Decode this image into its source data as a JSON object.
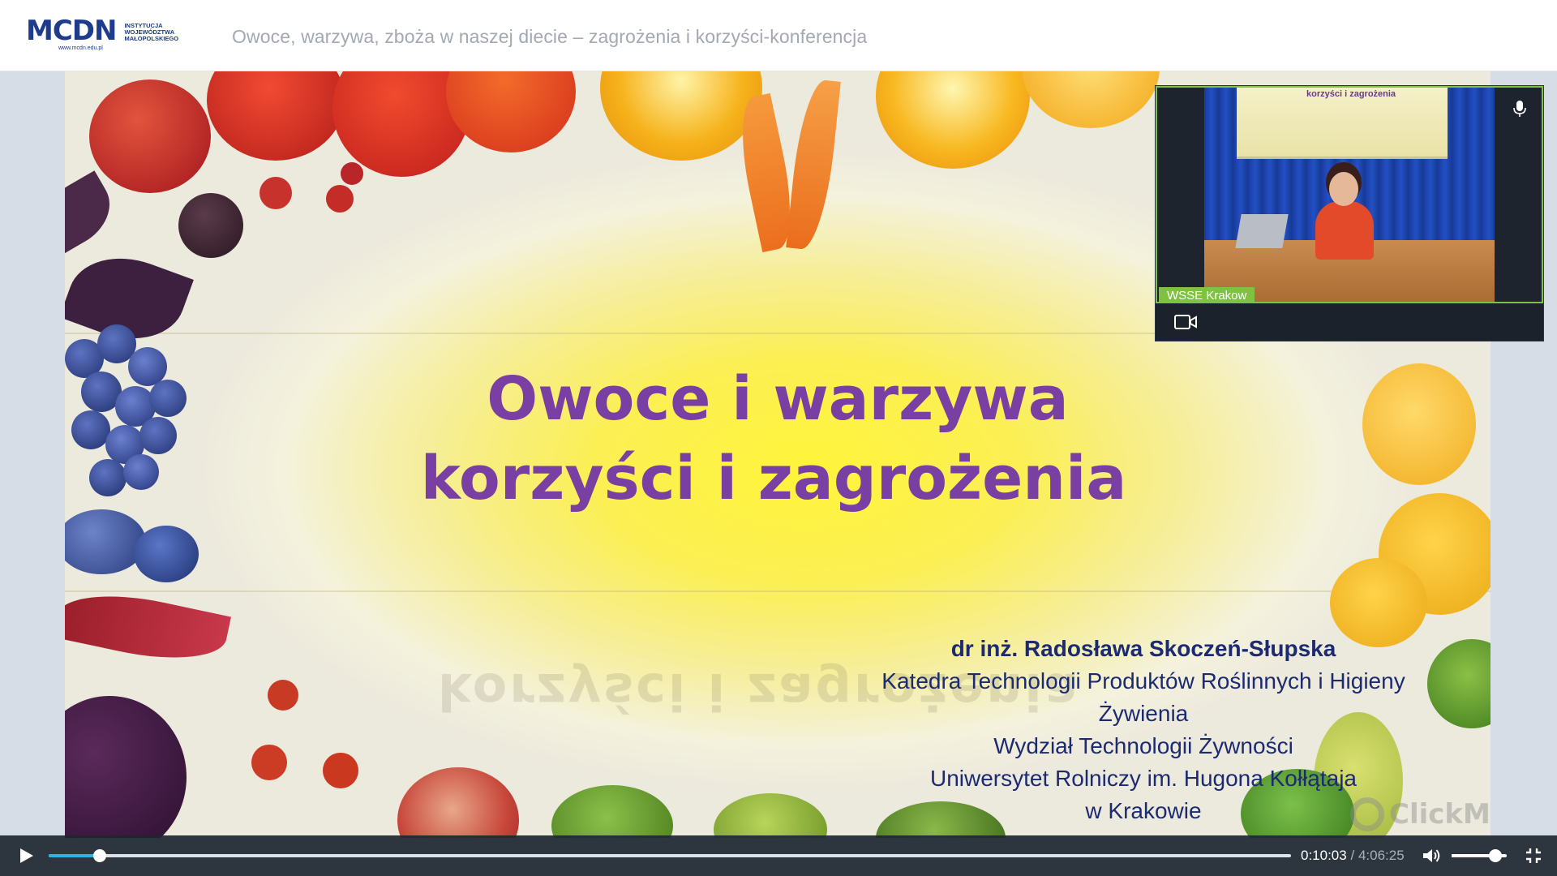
{
  "header": {
    "logo_word": "MCDN",
    "logo_url": "www.mcdn.edu.pl",
    "logo_institution": "Instytucja Województwa Małopolskiego",
    "title": "Owoce, warzywa, zboża w naszej diecie – zagrożenia i korzyści-konferencja"
  },
  "slide": {
    "title_line1": "Owoce i warzywa",
    "title_line2": "korzyści i zagrożenia",
    "mirror_text": "korzyści i zagrożenia",
    "author": "dr inż. Radosława Skoczeń-Słupska",
    "affiliation_1": "Katedra Technologii Produktów Roślinnych i Higieny",
    "affiliation_2": "Żywienia",
    "affiliation_3": "Wydział Technologii Żywności",
    "affiliation_4": "Uniwersytet Rolniczy im. Hugona Kołłątaja",
    "affiliation_5": "w Krakowie",
    "watermark": "ClickMeeting"
  },
  "webcam": {
    "label": "WSSE Krakow",
    "screen_text": "korzyści i zagrożenia",
    "icons": {
      "mic": "microphone-icon",
      "camera": "video-camera-icon"
    }
  },
  "player": {
    "current_time": "0:10:03",
    "separator": "/",
    "total_time": "4:06:25",
    "progress_fraction": 0.041,
    "volume_fraction": 0.8,
    "icons": {
      "play": "play-icon",
      "volume": "volume-icon",
      "fullscreen": "exit-fullscreen-icon"
    }
  },
  "colors": {
    "accent": "#2ab5e8",
    "webcam_border": "#7fc241",
    "slide_title": "#7a3fa3",
    "slide_text": "#1c2a72"
  }
}
